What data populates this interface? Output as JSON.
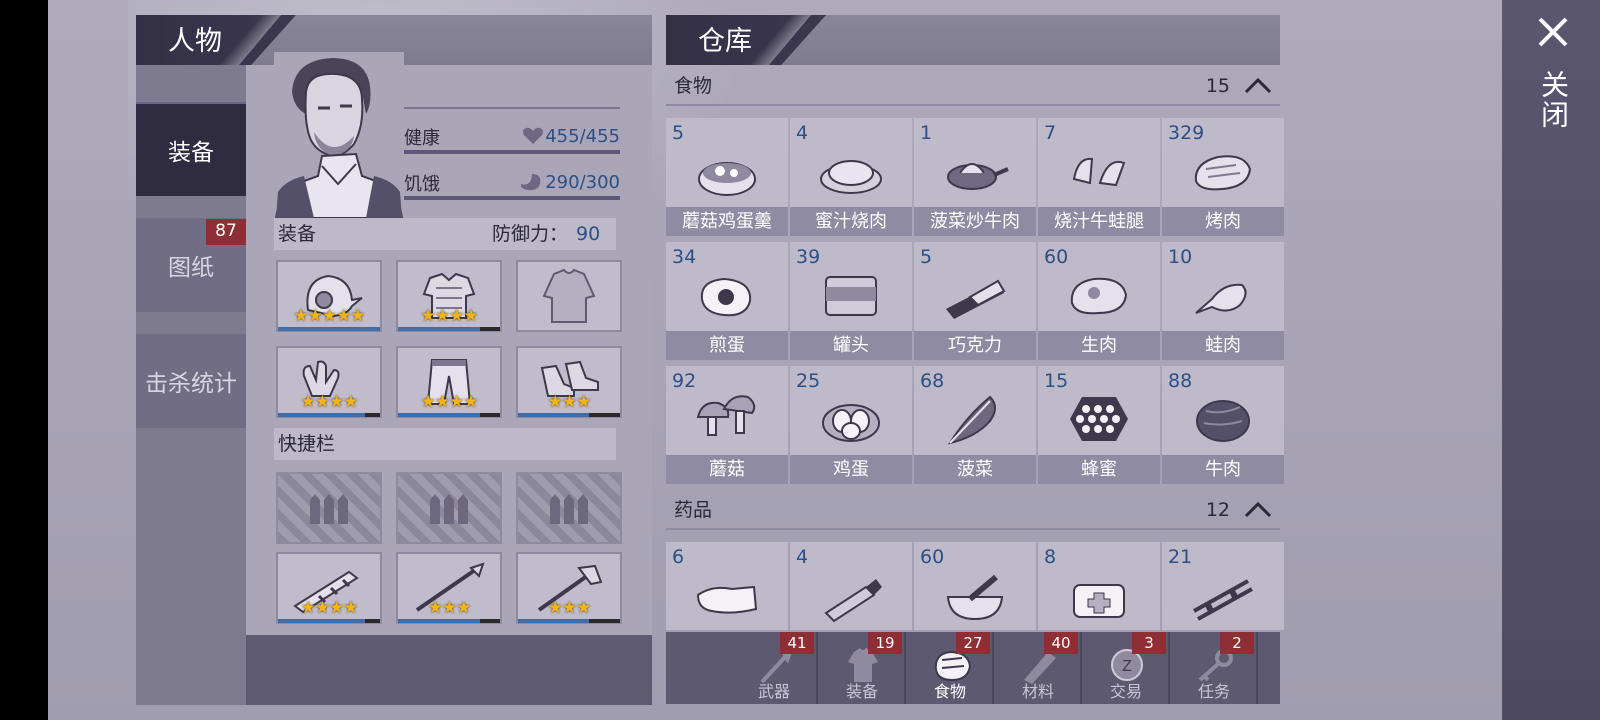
{
  "character": {
    "title": "人物",
    "tabs": [
      {
        "label": "装备"
      },
      {
        "label": "图纸",
        "badge": "87"
      },
      {
        "label": "击杀统计"
      }
    ],
    "stats": {
      "health_label": "健康",
      "health_value": "455/455",
      "hunger_label": "饥饿",
      "hunger_value": "290/300"
    },
    "equipment": {
      "section_label": "装备",
      "defense_label": "防御力：",
      "defense_value": "90",
      "slots": [
        {
          "icon": "helmet-icon",
          "stars": "★★★★★",
          "progress": 1.0
        },
        {
          "icon": "armor-icon",
          "stars": "★★★★",
          "progress": 0.8
        },
        {
          "icon": "shirt-icon",
          "stars": "",
          "progress": null
        },
        {
          "icon": "gloves-icon",
          "stars": "★★★★",
          "progress": 0.85
        },
        {
          "icon": "pants-icon",
          "stars": "★★★★",
          "progress": 0.8
        },
        {
          "icon": "shoes-icon",
          "stars": "★★★",
          "progress": 0.7
        }
      ]
    },
    "quickbar": {
      "section_label": "快捷栏",
      "slots": [
        {
          "icon": "empty-slot-icon",
          "stars": ""
        },
        {
          "icon": "empty-slot-icon",
          "stars": ""
        },
        {
          "icon": "empty-slot-icon",
          "stars": ""
        },
        {
          "icon": "bat-weapon-icon",
          "stars": "★★★★",
          "progress": 0.85
        },
        {
          "icon": "spear-weapon-icon",
          "stars": "★★★",
          "progress": 0.8
        },
        {
          "icon": "axe-weapon-icon",
          "stars": "★★★",
          "progress": 0.7
        }
      ]
    }
  },
  "warehouse": {
    "title": "仓库",
    "food": {
      "label": "食物",
      "count": "15",
      "items": [
        {
          "qty": "5",
          "name": "蘑菇鸡蛋羹",
          "icon": "soup-bowl-icon"
        },
        {
          "qty": "4",
          "name": "蜜汁烧肉",
          "icon": "glazed-meat-icon"
        },
        {
          "qty": "1",
          "name": "菠菜炒牛肉",
          "icon": "frying-pan-icon"
        },
        {
          "qty": "7",
          "name": "烧汁牛蛙腿",
          "icon": "frog-legs-icon"
        },
        {
          "qty": "329",
          "name": "烤肉",
          "icon": "roast-meat-icon"
        },
        {
          "qty": "34",
          "name": "煎蛋",
          "icon": "fried-egg-icon"
        },
        {
          "qty": "39",
          "name": "罐头",
          "icon": "can-icon"
        },
        {
          "qty": "5",
          "name": "巧克力",
          "icon": "chocolate-icon"
        },
        {
          "qty": "60",
          "name": "生肉",
          "icon": "raw-meat-icon"
        },
        {
          "qty": "10",
          "name": "蛙肉",
          "icon": "frog-meat-icon"
        },
        {
          "qty": "92",
          "name": "蘑菇",
          "icon": "mushroom-icon"
        },
        {
          "qty": "25",
          "name": "鸡蛋",
          "icon": "eggs-icon"
        },
        {
          "qty": "68",
          "name": "菠菜",
          "icon": "spinach-icon"
        },
        {
          "qty": "15",
          "name": "蜂蜜",
          "icon": "honeycomb-icon"
        },
        {
          "qty": "88",
          "name": "牛肉",
          "icon": "beef-icon"
        }
      ]
    },
    "medicine": {
      "label": "药品",
      "count": "12",
      "items": [
        {
          "qty": "6",
          "icon": "bandage-icon"
        },
        {
          "qty": "4",
          "icon": "ointment-icon"
        },
        {
          "qty": "60",
          "icon": "mortar-icon"
        },
        {
          "qty": "8",
          "icon": "medkit-icon"
        },
        {
          "qty": "21",
          "icon": "splint-icon"
        }
      ]
    },
    "footer_tabs": [
      {
        "label": "武器",
        "badge": "41",
        "icon": "axe-icon"
      },
      {
        "label": "装备",
        "badge": "19",
        "icon": "shirt-icon"
      },
      {
        "label": "食物",
        "badge": "27",
        "icon": "meat-icon"
      },
      {
        "label": "材料",
        "badge": "40",
        "icon": "wood-icon"
      },
      {
        "label": "交易",
        "badge": "3",
        "icon": "coin-icon"
      },
      {
        "label": "任务",
        "badge": "2",
        "icon": "key-icon"
      }
    ]
  },
  "close": {
    "label": "关闭"
  }
}
